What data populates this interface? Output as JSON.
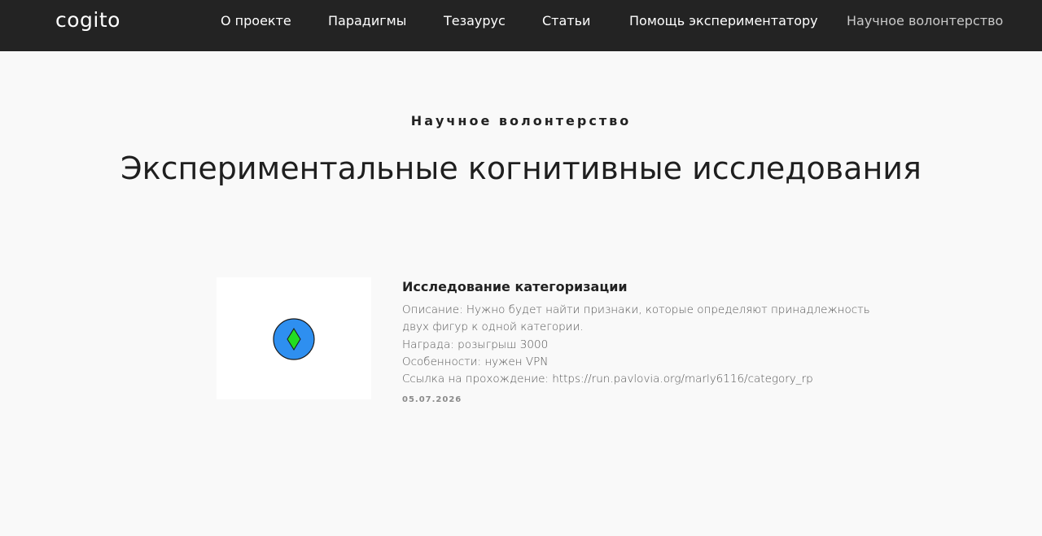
{
  "header": {
    "logo": "cogito",
    "nav": [
      {
        "label": "О проекте"
      },
      {
        "label": "Парадигмы"
      },
      {
        "label": "Тезаурус"
      },
      {
        "label": "Статьи"
      },
      {
        "label": "Помощь экспериментатору"
      },
      {
        "label": "Научное волонтерство"
      }
    ]
  },
  "page": {
    "eyebrow": "Научное волонтерство",
    "title": "Экспериментальные когнитивные исследования"
  },
  "card": {
    "title": "Исследование категоризации",
    "desc_line1": "Описание: Нужно будет найти признаки, которые определяют принадлежность",
    "desc_line2": "двух фигур к одной категории.",
    "reward": "Награда: розыгрыш 3000",
    "features": "Особенности: нужен VPN",
    "link": "Ссылка на прохождение: https://run.pavlovia.org/marly6116/category_rp",
    "date": "05.07.2026",
    "image": {
      "circle_color": "#2e8ff0",
      "diamond_color": "#22dd22"
    }
  },
  "colors": {
    "topbar": "#232323",
    "background": "#f9f9f9",
    "nav_active": "#c9c9c9"
  }
}
